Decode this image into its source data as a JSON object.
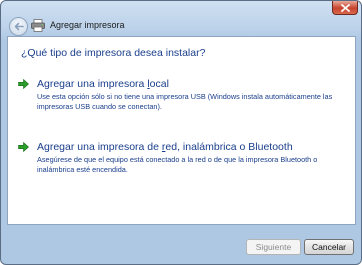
{
  "window": {
    "title": "Agregar impresora"
  },
  "main": {
    "heading": "¿Qué tipo de impresora desea instalar?",
    "options": [
      {
        "title_before": "Agregar una impresora ",
        "title_accel": "l",
        "title_after": "ocal",
        "description": "Use esta opción sólo si no tiene una impresora USB (Windows instala automáticamente las impresoras USB cuando se conectan)."
      },
      {
        "title_before": "Agregar una impresora de ",
        "title_accel": "r",
        "title_after": "ed, inalámbrica o Bluetooth",
        "description": "Asegúrese de que el equipo está conectado a la red o de que la impresora Bluetooth o inalámbrica esté encendida."
      }
    ]
  },
  "footer": {
    "next_label": "Siguiente",
    "cancel_label": "Cancelar"
  },
  "icons": {
    "option_arrow": "green-arrow-icon",
    "back": "back-arrow-icon",
    "app": "printer-icon",
    "close": "close-icon"
  },
  "colors": {
    "link_text": "#1a3e8c",
    "arrow": "#2a9d2a",
    "close_button": "#c7442d"
  }
}
